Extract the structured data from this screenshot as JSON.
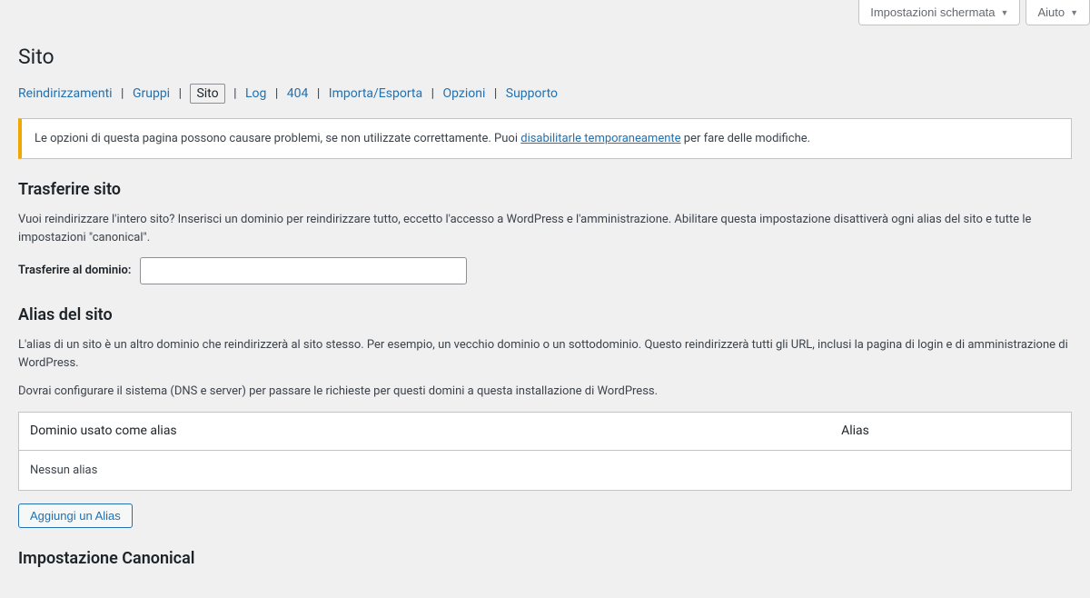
{
  "screen_meta": {
    "screen_options": "Impostazioni schermata",
    "help": "Aiuto"
  },
  "page_title": "Sito",
  "tabs": {
    "reindirizzamenti": "Reindirizzamenti",
    "gruppi": "Gruppi",
    "sito": "Sito",
    "log": "Log",
    "e404": "404",
    "importa_esporta": "Importa/Esporta",
    "opzioni": "Opzioni",
    "supporto": "Supporto"
  },
  "notice": {
    "text_before": "Le opzioni di questa pagina possono causare problemi, se non utilizzate correttamente. Puoi ",
    "link": "disabilitarle temporaneamente",
    "text_after": " per fare delle modifiche."
  },
  "transfer": {
    "title": "Trasferire sito",
    "desc": "Vuoi reindirizzare l'intero sito? Inserisci un dominio per reindirizzare tutto, eccetto l'accesso a WordPress e l'amministrazione. Abilitare questa impostazione disattiverà ogni alias del sito e tutte le impostazioni \"canonical\".",
    "label": "Trasferire al dominio:",
    "value": ""
  },
  "alias": {
    "title": "Alias del sito",
    "desc1": "L'alias di un sito è un altro dominio che reindirizzerà al sito stesso. Per esempio, un vecchio dominio o un sottodominio. Questo reindirizzerà tutti gli URL, inclusi la pagina di login e di amministrazione di WordPress.",
    "desc2": "Dovrai configurare il sistema (DNS e server) per passare le richieste per questi domini a questa installazione di WordPress.",
    "col1": "Dominio usato come alias",
    "col2": "Alias",
    "empty": "Nessun alias",
    "add_button": "Aggiungi un Alias"
  },
  "canonical": {
    "title": "Impostazione Canonical"
  }
}
